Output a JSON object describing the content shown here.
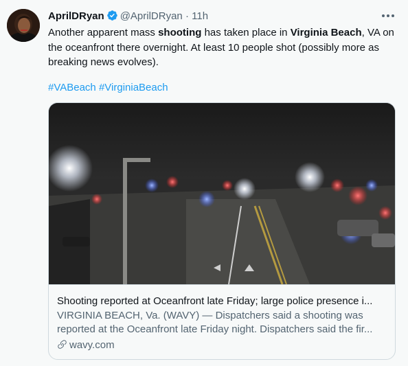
{
  "tweet": {
    "author": {
      "display_name": "AprilDRyan",
      "handle": "@AprilDRyan",
      "verified": true
    },
    "separator": "·",
    "time": "11h",
    "text": {
      "p1": "Another apparent mass ",
      "b1": "shooting",
      "p2": " has taken place in ",
      "b2": "Virginia Beach",
      "p3": ", VA on the oceanfront there overnight. At least 10 people shot (possibly more as breaking news evolves)."
    },
    "hashtags": [
      "#VABeach",
      "#VirginiaBeach"
    ],
    "card": {
      "title": "Shooting reported at Oceanfront late Friday; large police presence i...",
      "description_line1": "VIRGINIA BEACH, Va. (WAVY) — Dispatchers said a shooting was",
      "description_line2": "reported at the Oceanfront late Friday night. Dispatchers said the fir...",
      "domain": "wavy.com"
    }
  },
  "colors": {
    "link": "#1d9bf0",
    "secondary_text": "#536471",
    "border": "#cfd9de",
    "background": "#f7f9f9"
  },
  "icons": {
    "verified": "verified-badge-icon",
    "more": "more-horizontal-icon",
    "link": "link-icon"
  }
}
